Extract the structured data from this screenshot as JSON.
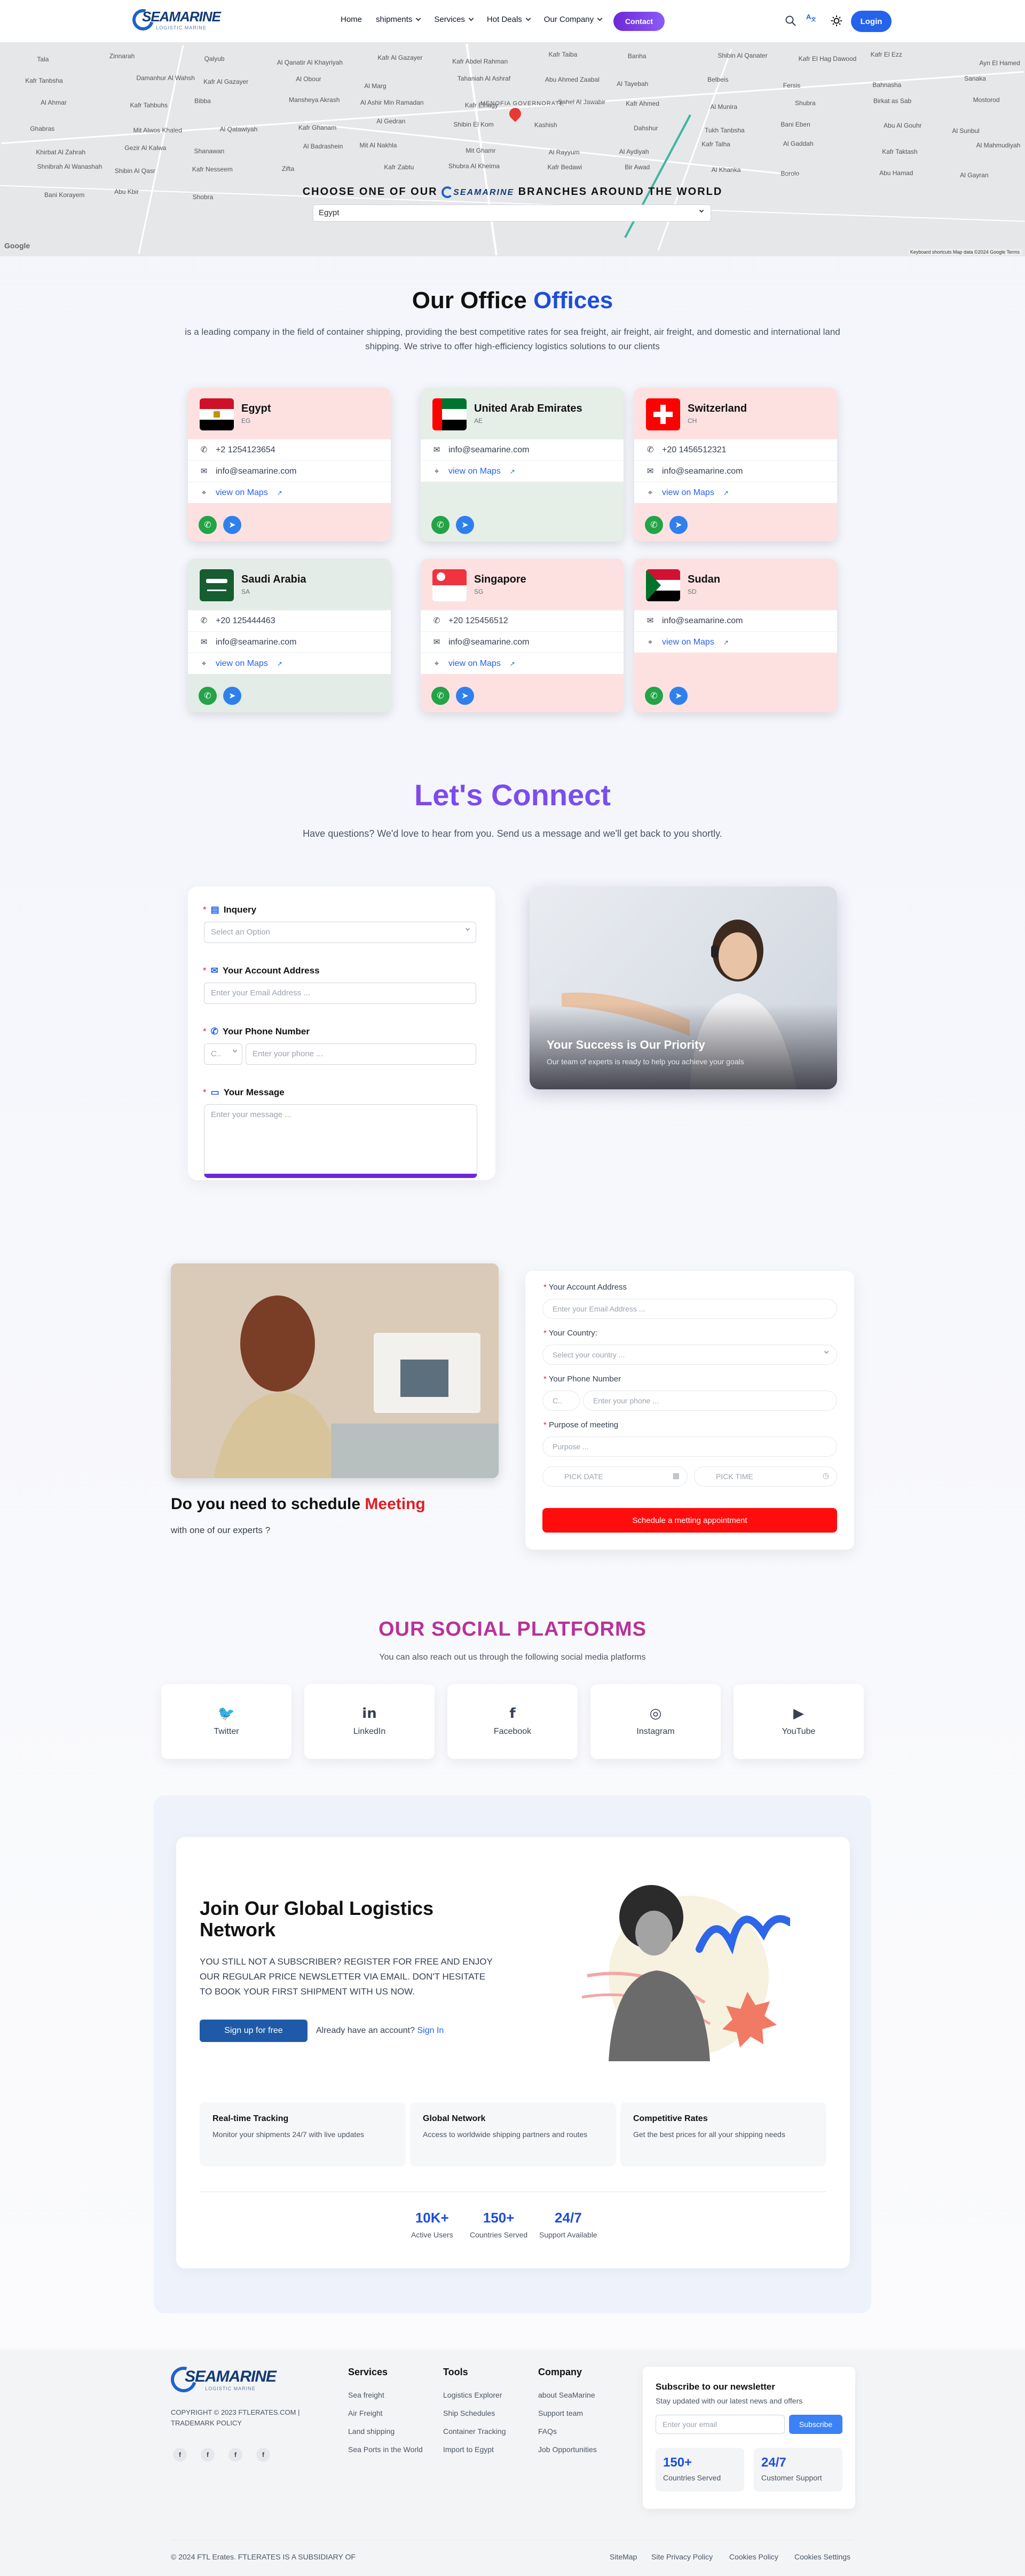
{
  "header": {
    "logo_text": "SEAMARINE",
    "logo_sub": "LOGISTIC MARINE",
    "nav": [
      {
        "label": "Home",
        "dropdown": false
      },
      {
        "label": "shipments",
        "dropdown": true
      },
      {
        "label": "Services",
        "dropdown": true
      },
      {
        "label": "Hot Deals",
        "dropdown": true
      },
      {
        "label": "Our Company",
        "dropdown": true
      }
    ],
    "contact_label": "Contact",
    "login_label": "Login"
  },
  "map": {
    "labels": [
      "Tala",
      "Zinnarah",
      "Qalyub",
      "Al Qanatir Al Khayriyah",
      "Kafr Al Gazayer",
      "Kafr Abdel Rahman",
      "Kafr Taiba",
      "Banha",
      "Shibin Al Qanater",
      "Kafr El Hag Dawood",
      "Kafr El Ezz",
      "Ayn El Hamed",
      "Kafr Tanbsha",
      "Damanhur Al Wahsh",
      "Kafr Al Gazayer",
      "Al Obour",
      "Al Marg",
      "Tahaniah Al Ashraf",
      "Abu Ahmed Zaabal",
      "Al Tayebah",
      "Belbeis",
      "Fersis",
      "Bahnasha",
      "Sanaka",
      "Al Ahmar",
      "Kafr Tahbuhs",
      "Bibba",
      "Mansheya Akrash",
      "Al Ashir Min Ramadan",
      "Kafr Elhagy",
      "Sahel Al Jawabir",
      "Kafr Ahmed",
      "Al Munira",
      "Shubra",
      "Birkat as Sab",
      "Mostorod",
      "Ghabras",
      "Mit Alwos Khaled",
      "Al Qatawiyah",
      "Kafr Ghanam",
      "Al Gedran",
      "Shibin El Kom",
      "Kashish",
      "Dahshur",
      "Tukh Tanbsha",
      "Bani Eben",
      "Abu Al Gouhr",
      "Al Sunbul",
      "Khirbat Al Zahrah",
      "Gezir Al Kalwa",
      "Shanawan",
      "Al Badrashein",
      "Mit Al Nakhla",
      "Mit Ghamr",
      "Al Rayyum",
      "Al Aydiyah",
      "Kafr Talha",
      "Al Gaddah",
      "Kafr Taktash",
      "Al Mahmudiyah",
      "Shnibrah Al Wanashah",
      "Shibin Al Qasr",
      "Kafr Nesseem",
      "Zifta",
      "Kafr Zabtu",
      "Shubra Al Kheima",
      "Kafr Bedawi",
      "Bir Awad",
      "Al Khanka",
      "Borolo",
      "Abu Hamad",
      "Al Gayran",
      "Bani Korayem",
      "Abu Kbir",
      "Shobra"
    ],
    "title_prefix": "CHOOSE ONE OF OUR",
    "title_suffix": "BRANCHES AROUND THE WORLD",
    "select_value": "Egypt",
    "attribution": "Keyboard shortcuts   Map data ©2024 Google   Terms",
    "google_logo": "Google",
    "region_label": "MENOFIA GOVERNORATE"
  },
  "offices": {
    "title_a": "Our Office",
    "title_b": "Offices",
    "desc": "is a leading company in the field of container shipping, providing the best competitive rates for sea freight, air freight, air freight, and domestic and international land shipping. We strive to offer high-efficiency logistics solutions to our clients",
    "cards": [
      {
        "name": "Egypt",
        "code": "EG",
        "phone": "+2 1254123654",
        "email": "info@seamarine.com",
        "maps": "view on Maps"
      },
      {
        "name": "United Arab Emirates",
        "code": "AE",
        "phone": "",
        "email": "info@seamarine.com",
        "maps": "view on Maps"
      },
      {
        "name": "Switzerland",
        "code": "CH",
        "phone": "+20 1456512321",
        "email": "info@seamarine.com",
        "maps": "view on Maps"
      },
      {
        "name": "Saudi Arabia",
        "code": "SA",
        "phone": "+20 125444463",
        "email": "info@seamarine.com",
        "maps": "view on Maps"
      },
      {
        "name": "Singapore",
        "code": "SG",
        "phone": "+20 125456512",
        "email": "info@seamarine.com",
        "maps": "view on Maps"
      },
      {
        "name": "Sudan",
        "code": "SD",
        "phone": "",
        "email": "info@seamarine.com",
        "maps": "view on Maps"
      }
    ]
  },
  "connect": {
    "title": "Let's Connect",
    "desc": "Have questions? We'd love to hear from you. Send us a message and we'll get back to you shortly.",
    "inquiry_label": "Inquery",
    "inquiry_placeholder": "Select an Option",
    "email_label": "Your Account Address",
    "email_placeholder": "Enter your Email Address ...",
    "phone_label": "Your Phone Number",
    "phone_code": "C..",
    "phone_placeholder": "Enter your phone ...",
    "message_label": "Your Message",
    "message_placeholder": "Enter your message ...",
    "image_title": "Your Success is Our Priority",
    "image_sub": "Our team of experts is ready to help you achieve your goals"
  },
  "meeting": {
    "title_a": "Do you need to schedule",
    "title_b": "Meeting",
    "sub": "with one of our experts ?",
    "email_label": "Your Account Address",
    "email_placeholder": "Enter your Email Address ...",
    "country_label": "Your Country:",
    "country_placeholder": "Select your country ...",
    "phone_label": "Your Phone Number",
    "phone_code": "C..",
    "phone_placeholder": "Enter your phone ...",
    "purpose_label": "Purpose of meeting",
    "purpose_placeholder": "Purpose ...",
    "date_placeholder": "PICK DATE",
    "time_placeholder": "PICK TIME",
    "submit_label": "Schedule a metting appointment"
  },
  "social": {
    "title": "OUR SOCIAL PLATFORMS",
    "desc": "You can also reach out us through the following social media platforms",
    "items": [
      {
        "label": "Twitter",
        "icon": "twitter-icon"
      },
      {
        "label": "LinkedIn",
        "icon": "linkedin-icon"
      },
      {
        "label": "Facebook",
        "icon": "facebook-icon"
      },
      {
        "label": "Instagram",
        "icon": "instagram-icon"
      },
      {
        "label": "YouTube",
        "icon": "youtube-icon"
      }
    ]
  },
  "join": {
    "title": "Join Our Global Logistics Network",
    "desc": "YOU STILL NOT A SUBSCRIBER? REGISTER FOR FREE AND ENJOY OUR REGULAR PRICE NEWSLETTER VIA EMAIL. DON'T HESITATE TO BOOK YOUR FIRST SHIPMENT WITH US NOW.",
    "signup_label": "Sign up for free",
    "account_text": "Already have an account?",
    "signin_label": "Sign In",
    "features": [
      {
        "title": "Real-time Tracking",
        "desc": "Monitor your shipments 24/7 with live updates"
      },
      {
        "title": "Global Network",
        "desc": "Access to worldwide shipping partners and routes"
      },
      {
        "title": "Competitive Rates",
        "desc": "Get the best prices for all your shipping needs"
      }
    ],
    "stats": [
      {
        "value": "10K+",
        "label": "Active Users"
      },
      {
        "value": "150+",
        "label": "Countries Served"
      },
      {
        "value": "24/7",
        "label": "Support Available"
      }
    ]
  },
  "footer": {
    "copyright": "COPYRIGHT © 2023 FTLERATES.COM | TRADEMARK POLICY",
    "columns": [
      {
        "title": "Services",
        "links": [
          "Sea freight",
          "Air Freight",
          "Land shipping",
          "Sea Ports in the World"
        ]
      },
      {
        "title": "Tools",
        "links": [
          "Logistics Explorer",
          "Ship Schedules",
          "Container Tracking",
          "Import to Egypt"
        ]
      },
      {
        "title": "Company",
        "links": [
          "about SeaMarine",
          "Support team",
          "FAQs",
          "Job Opportunities"
        ]
      }
    ],
    "newsletter": {
      "title": "Subscribe to our newsletter",
      "desc": "Stay updated with our latest news and offers",
      "placeholder": "Enter your email",
      "button": "Subscribe",
      "stats": [
        {
          "value": "150+",
          "label": "Countries Served"
        },
        {
          "value": "24/7",
          "label": "Customer Support"
        }
      ]
    },
    "bottom_left": "© 2024 FTL Erates. FTLERATES IS A SUBSIDIARY OF",
    "bottom_links": [
      "SiteMap",
      "Site Privacy Policy",
      "Cookies Policy",
      "Cookies Settings"
    ],
    "social_letters": [
      "f",
      "f",
      "f",
      "f"
    ]
  }
}
